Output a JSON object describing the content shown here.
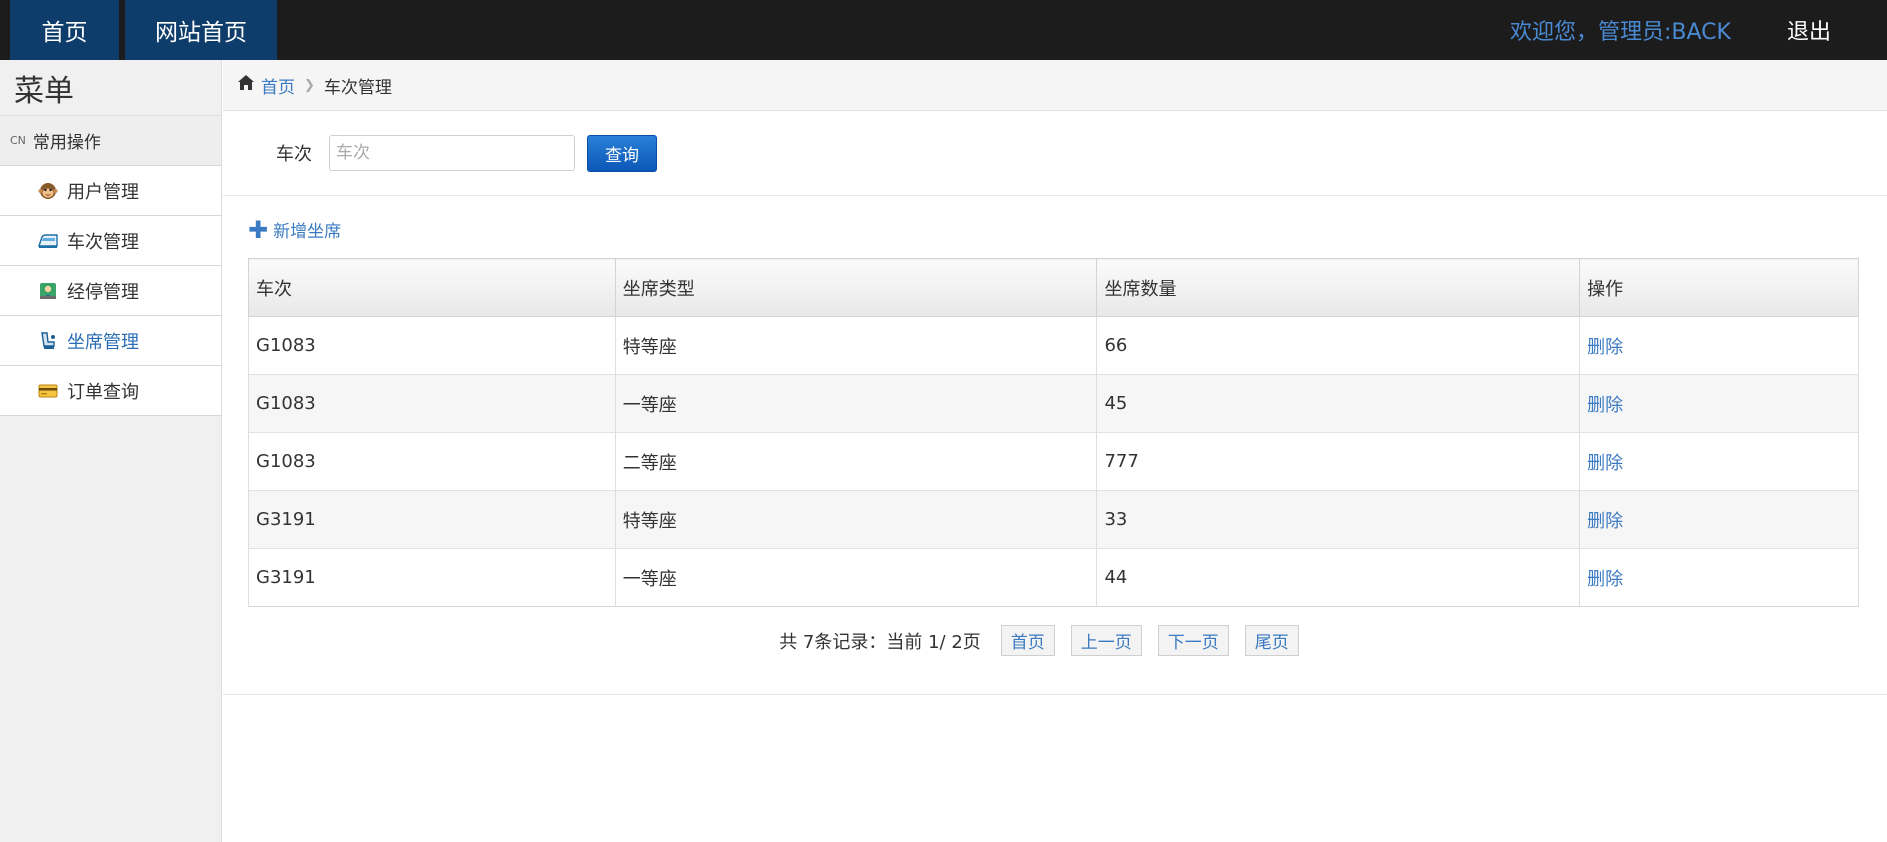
{
  "topbar": {
    "nav": [
      {
        "label": "首页"
      },
      {
        "label": "网站首页"
      }
    ],
    "welcome": "欢迎您，管理员:BACK",
    "logout": "退出"
  },
  "sidebar": {
    "title": "菜单",
    "group": {
      "prefix": "CN",
      "label": "常用操作"
    },
    "items": [
      {
        "label": "用户管理",
        "icon": "monkey-icon"
      },
      {
        "label": "车次管理",
        "icon": "train-icon"
      },
      {
        "label": "经停管理",
        "icon": "station-icon"
      },
      {
        "label": "坐席管理",
        "icon": "seat-icon",
        "active": true
      },
      {
        "label": "订单查询",
        "icon": "card-icon"
      }
    ]
  },
  "breadcrumb": {
    "home": "首页",
    "current": "车次管理"
  },
  "search": {
    "label": "车次",
    "placeholder": "车次",
    "value": "",
    "button": "查询"
  },
  "add_link": "新增坐席",
  "table": {
    "headers": [
      "车次",
      "坐席类型",
      "坐席数量",
      "操作"
    ],
    "rows": [
      {
        "train": "G1083",
        "seat_type": "特等座",
        "count": "66",
        "action": "删除"
      },
      {
        "train": "G1083",
        "seat_type": "一等座",
        "count": "45",
        "action": "删除"
      },
      {
        "train": "G1083",
        "seat_type": "二等座",
        "count": "777",
        "action": "删除"
      },
      {
        "train": "G3191",
        "seat_type": "特等座",
        "count": "33",
        "action": "删除"
      },
      {
        "train": "G3191",
        "seat_type": "一等座",
        "count": "44",
        "action": "删除"
      }
    ]
  },
  "pager": {
    "info": "共 7条记录：当前 1/ 2页",
    "first": "首页",
    "prev": "上一页",
    "next": "下一页",
    "last": "尾页"
  },
  "colors": {
    "topbar": "#1c1c1c",
    "nav_button": "#0e3d6b",
    "link": "#3a7ac2",
    "primary_button": "#0b57b8"
  }
}
